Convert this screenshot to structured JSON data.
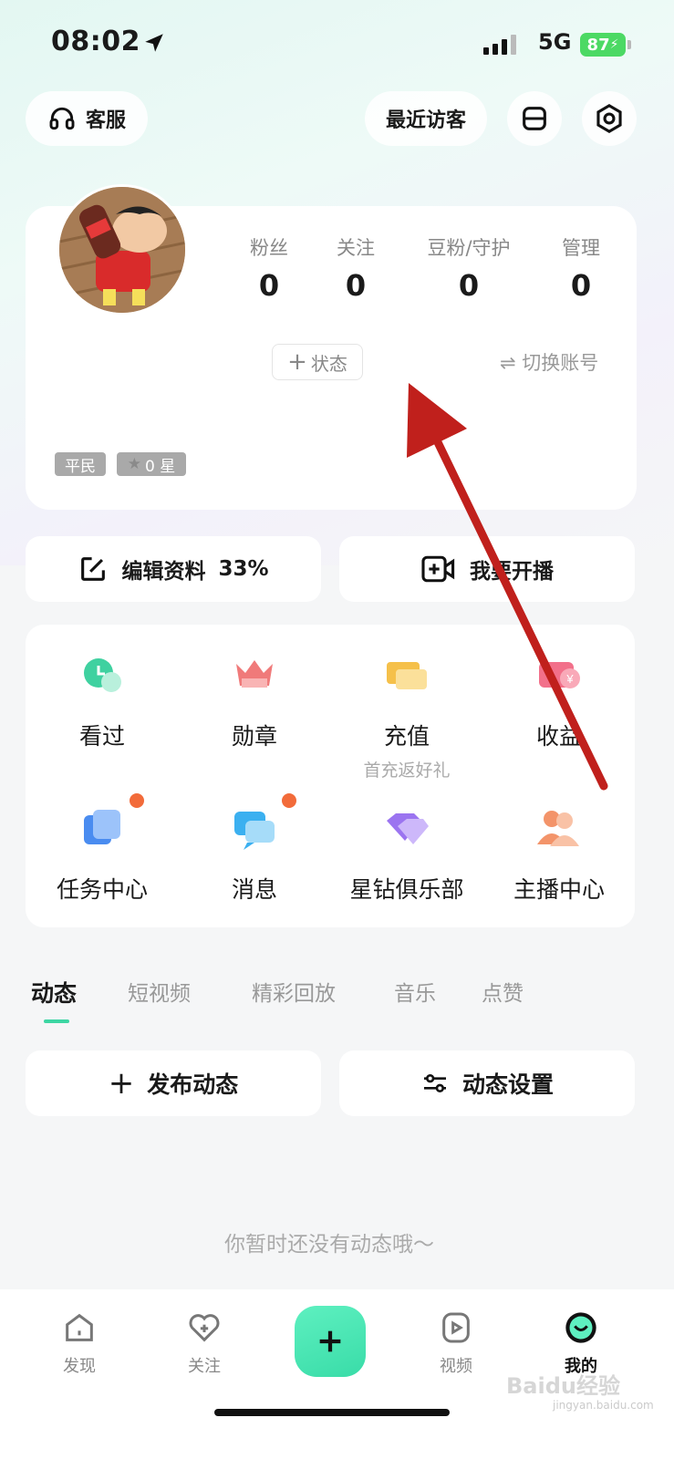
{
  "status_bar": {
    "time": "08:02",
    "network": "5G",
    "battery": "87"
  },
  "header": {
    "service_label": "客服",
    "visitors_label": "最近访客"
  },
  "profile": {
    "stats": [
      {
        "label": "粉丝",
        "value": "0"
      },
      {
        "label": "关注",
        "value": "0"
      },
      {
        "label": "豆粉/守护",
        "value": "0"
      },
      {
        "label": "管理",
        "value": "0"
      }
    ],
    "status_button": "状态",
    "switch_account": "切换账号",
    "rank_tag": "平民",
    "star_tag": "0 星"
  },
  "actions": {
    "edit_label": "编辑资料",
    "edit_progress": "33%",
    "live_label": "我要开播"
  },
  "grid": [
    {
      "label": "看过",
      "icon": "history-icon",
      "color": "#3fd1a0"
    },
    {
      "label": "勋章",
      "icon": "medal-crown-icon",
      "color": "#f07a7a"
    },
    {
      "label": "充值",
      "sub": "首充返好礼",
      "icon": "ticket-icon",
      "color": "#f5c04a"
    },
    {
      "label": "收益",
      "icon": "wallet-icon",
      "color": "#f2708a"
    },
    {
      "label": "任务中心",
      "icon": "task-icon",
      "color": "#4a8cf0"
    },
    {
      "label": "消息",
      "icon": "message-icon",
      "color": "#3bb0f0"
    },
    {
      "label": "星钻俱乐部",
      "icon": "diamond-icon",
      "color": "#9b74f0"
    },
    {
      "label": "主播中心",
      "icon": "anchor-icon",
      "color": "#f3946a"
    }
  ],
  "tabs": [
    "动态",
    "短视频",
    "精彩回放",
    "音乐",
    "点赞"
  ],
  "posts": {
    "new_label": "发布动态",
    "settings_label": "动态设置"
  },
  "empty_text": "你暂时还没有动态哦～",
  "bottom_nav": [
    {
      "label": "发现",
      "icon": "home-icon"
    },
    {
      "label": "关注",
      "icon": "heart-plus-icon"
    },
    {
      "label": "视频",
      "icon": "play-icon"
    },
    {
      "label": "我的",
      "icon": "smile-face-icon"
    }
  ],
  "watermark": {
    "main": "Baidu经验",
    "sub": "jingyan.baidu.com"
  }
}
